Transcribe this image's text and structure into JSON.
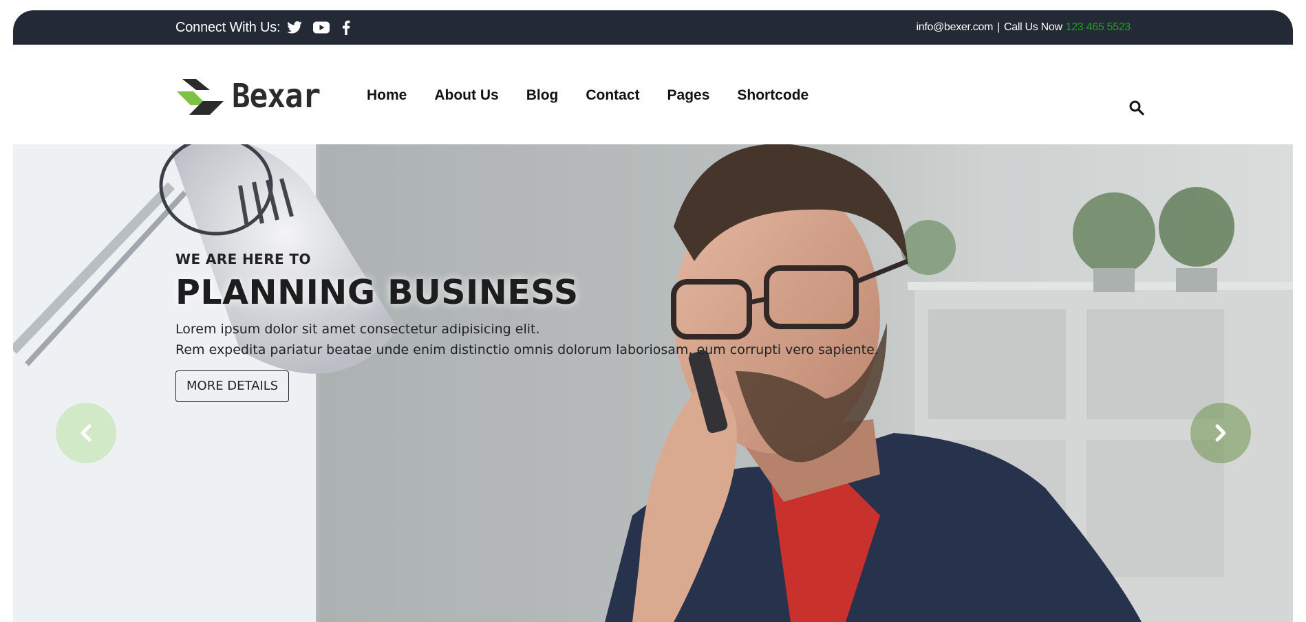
{
  "topbar": {
    "connect_label": "Connect With Us:",
    "social_icons": [
      "twitter-icon",
      "youtube-icon",
      "facebook-icon"
    ],
    "email": "info@bexer.com",
    "separator": "|",
    "call_label": "Call Us Now",
    "phone": "123 465 5523",
    "colors": {
      "background": "#232a35",
      "phone": "#21a023"
    }
  },
  "header": {
    "logo_text": "Bexar",
    "nav": {
      "home": "Home",
      "about": "About Us",
      "blog": "Blog",
      "contact": "Contact",
      "pages": "Pages",
      "shortcode": "Shortcode"
    },
    "search_icon": "search-icon"
  },
  "hero": {
    "eyebrow": "WE ARE HERE TO",
    "title": "PLANNING BUSINESS",
    "desc_line1": "Lorem ipsum dolor sit amet consectetur adipisicing elit.",
    "desc_line2": "Rem expedita pariatur beatae unde enim distinctio omnis dolorum laboriosam, eum corrupti vero sapiente.",
    "button_label": "MORE DETAILS",
    "prev_icon": "chevron-left-icon",
    "next_icon": "chevron-right-icon"
  }
}
